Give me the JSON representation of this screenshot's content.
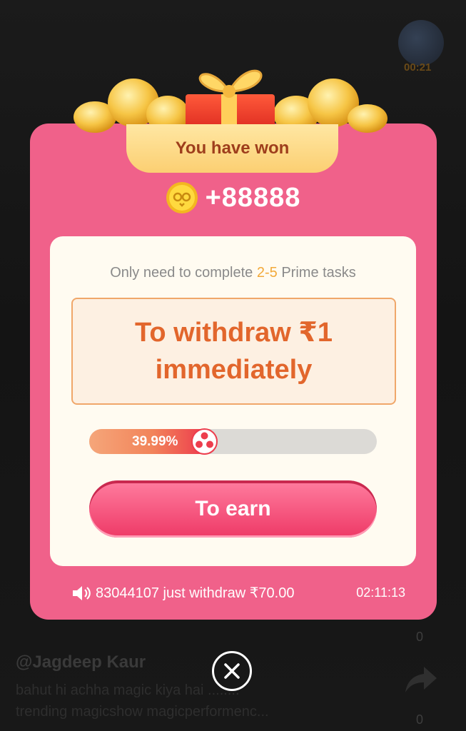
{
  "background": {
    "timer": "00:21",
    "username": "@Jagdeep Kaur",
    "caption_line1": "bahut hi achha magic kiya hai ........",
    "caption_line2": "trending magicshow magicperformenc...",
    "count_top": "0",
    "count_bottom": "0"
  },
  "popup": {
    "title": "You have won",
    "amount": "+88888",
    "info_prefix": "Only need to complete ",
    "info_highlight": "2-5",
    "info_suffix": " Prime tasks",
    "withdraw_text": "To withdraw ₹1\nimmediately",
    "progress_label": "39.99%",
    "progress_value": 0.4,
    "earn_button": "To earn",
    "ticker_text": "83044107 just withdraw ₹70.00",
    "ticker_time": "02:11:13"
  },
  "icons": {
    "coin": "owl-coin-icon",
    "speaker": "speaker-icon",
    "close": "close-icon",
    "knob": "pinwheel-icon",
    "share": "share-icon"
  },
  "colors": {
    "card": "#f0618a",
    "panel": "#fffbf1",
    "accent_orange": "#e2662c",
    "highlight": "#f2a93a",
    "button": "#ee3966"
  }
}
